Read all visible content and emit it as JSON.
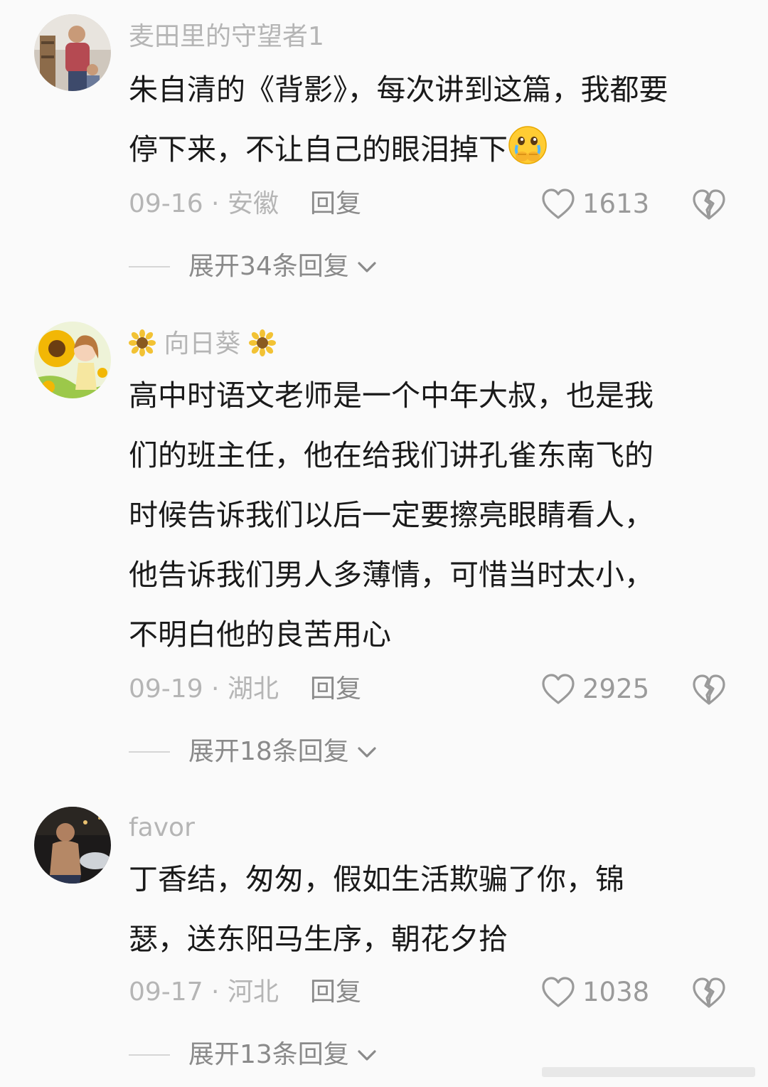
{
  "comments": [
    {
      "username": "麦田里的守望者1",
      "lines": [
        "朱自清的《背影》，每次讲到这篇，我都要",
        "停下来，不让自己的眼泪掉下"
      ],
      "emoji": "crying-face-emoji",
      "date_location": "09-16 · 安徽",
      "reply_label": "回复",
      "likes": "1613",
      "expand_label": "展开34条回复"
    },
    {
      "username": "向日葵",
      "username_decoration": "sunflower-icon",
      "lines": [
        "高中时语文老师是一个中年大叔，也是我",
        "们的班主任，他在给我们讲孔雀东南飞的",
        "时候告诉我们以后一定要擦亮眼睛看人，",
        "他告诉我们男人多薄情，可惜当时太小，",
        "不明白他的良苦用心"
      ],
      "date_location": "09-19 · 湖北",
      "reply_label": "回复",
      "likes": "2925",
      "expand_label": "展开18条回复"
    },
    {
      "username": "favor",
      "lines": [
        "丁香结，匆匆，假如生活欺骗了你，锦",
        "瑟，送东阳马生序，朝花夕拾"
      ],
      "date_location": "09-17 · 河北",
      "reply_label": "回复",
      "likes": "1038",
      "expand_label": "展开13条回复"
    }
  ],
  "icons": {
    "like": "heart-outline-icon",
    "dislike": "broken-heart-icon",
    "expand": "chevron-down-icon"
  },
  "colors": {
    "background": "#fafafa",
    "text": "#1a1a1a",
    "muted": "#b5b5b5",
    "reply": "#8a8a8a"
  }
}
